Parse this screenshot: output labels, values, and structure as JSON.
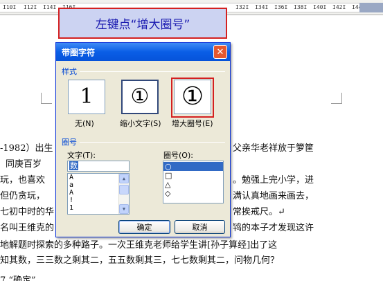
{
  "ruler": {
    "numbers": [
      "I10I",
      "I12I",
      "I14I",
      "I16I",
      "I32I",
      "I34I",
      "I36I",
      "I38I",
      "I40I",
      "I42I",
      "I44I"
    ]
  },
  "callout": {
    "text": "左键点“增大圈号”"
  },
  "document": {
    "lines": [
      "-1982）出生",
      "同庚百岁",
      "玩，也喜欢",
      "但仍贪玩，",
      "七初中时的华",
      "名叫王维克的",
      "地解题时探索的多种路子。一次王维克老师给学生讲[孙子算经]出了这",
      "知其数，三三数之剩其二，五五数剩其三，七七数剩其二，问物几何？",
      "7  “确定”"
    ],
    "right_fragments": [
      "父亲华老祥放于箩筐",
      "。勉强上完小学，进",
      "满认真地画来画去，",
      "常挨戒尺。↵",
      "鸨的本子才发现这许"
    ]
  },
  "dialog": {
    "title": "带圈字符",
    "close_label": "✕",
    "style_group_label": "样式",
    "styles": [
      {
        "glyph": "1",
        "caption": "无(N)"
      },
      {
        "glyph": "①",
        "caption": "缩小文字(S)"
      },
      {
        "glyph": "①",
        "caption": "增大圈号(E)"
      }
    ],
    "circle_group_label": "圈号",
    "text_label": "文字(T):",
    "text_value": "数",
    "text_list": [
      "A",
      "a",
      "A",
      "!",
      "1"
    ],
    "enclosure_label": "圈号(O):",
    "enclosures": [
      "○",
      "□",
      "△",
      "◇"
    ],
    "ok_label": "确定",
    "cancel_label": "取消"
  }
}
